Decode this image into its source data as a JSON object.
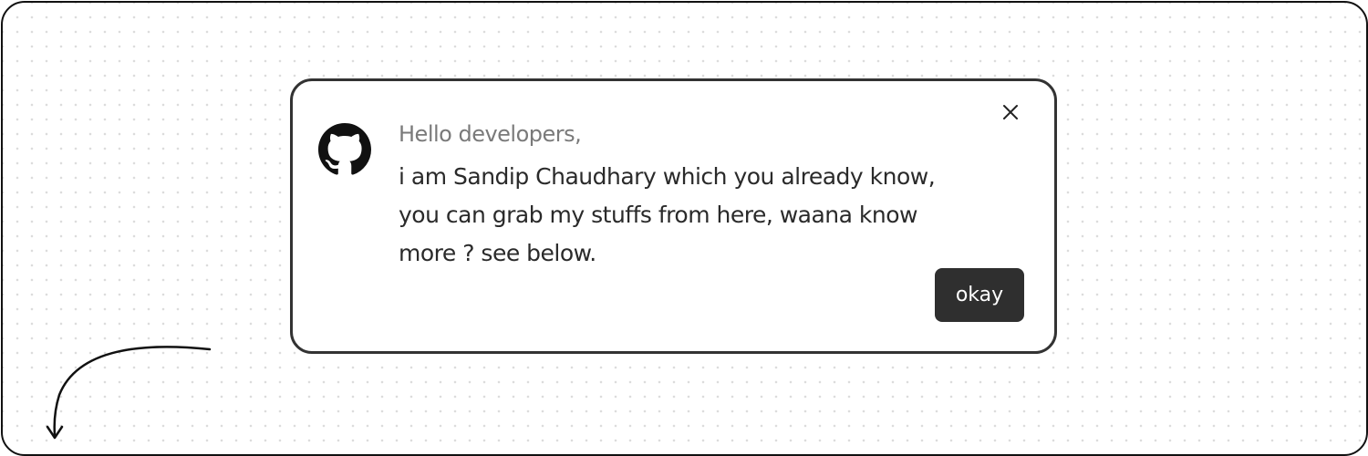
{
  "dialog": {
    "greeting": "Hello developers,",
    "message": "i am Sandip Chaudhary which you already know, you can grab my stuffs from here, waana know more ? see below.",
    "okay_label": "okay",
    "icon": "github-icon",
    "close_icon": "close-icon"
  },
  "decoration": {
    "arrow_icon": "curved-arrow-down-icon"
  },
  "colors": {
    "frame_border": "#111111",
    "card_border": "#333333",
    "button_bg": "#2f2f2f",
    "greeting_text": "#7a7a7a",
    "message_text": "#2a2a2a"
  }
}
